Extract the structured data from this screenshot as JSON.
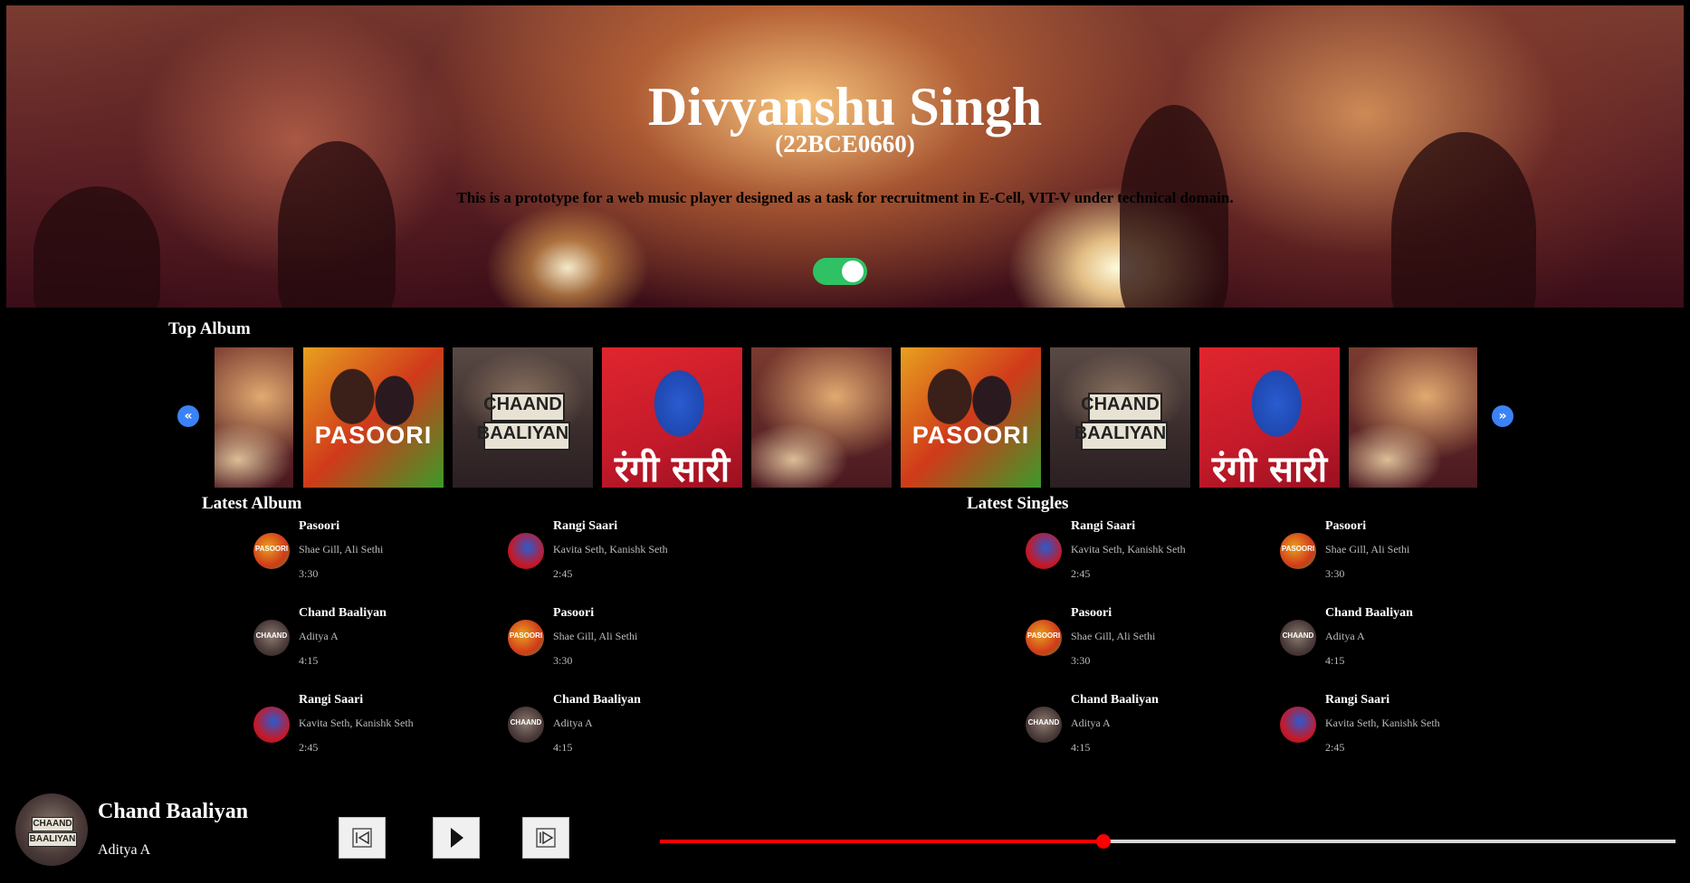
{
  "hero": {
    "title": "Divyanshu Singh",
    "subtitle": "(22BCE0660)",
    "description": "This is a prototype for a web music player designed as a task for recruitment in E-Cell, VIT-V under technical domain.",
    "theme_toggle_on": true
  },
  "top_album": {
    "heading": "Top Album",
    "prev_icon": "double-chevron-left-icon",
    "next_icon": "double-chevron-right-icon",
    "tiles": [
      {
        "kind": "concert",
        "label": ""
      },
      {
        "kind": "pasoori",
        "label": "PASOORI"
      },
      {
        "kind": "chaand",
        "label": "CHAAND",
        "label2": "BAALIYAN"
      },
      {
        "kind": "rangi",
        "label": "रंगी सारी"
      },
      {
        "kind": "concert",
        "label": ""
      },
      {
        "kind": "pasoori",
        "label": "PASOORI"
      },
      {
        "kind": "chaand",
        "label": "CHAAND",
        "label2": "BAALIYAN"
      },
      {
        "kind": "rangi",
        "label": "रंगी सारी"
      },
      {
        "kind": "concert",
        "label": ""
      }
    ]
  },
  "latest_album": {
    "heading": "Latest Album",
    "songs": [
      {
        "name": "Pasoori",
        "artist": "Shae Gill, Ali Sethi",
        "duration": "3:30",
        "cover": "pasoori",
        "cover_text": "PASOORI"
      },
      {
        "name": "Rangi Saari",
        "artist": "Kavita Seth, Kanishk Seth",
        "duration": "2:45",
        "cover": "rangi",
        "cover_text": ""
      },
      {
        "name": "Chand Baaliyan",
        "artist": "Aditya A",
        "duration": "4:15",
        "cover": "chaand",
        "cover_text": "CHAAND"
      },
      {
        "name": "Pasoori",
        "artist": "Shae Gill, Ali Sethi",
        "duration": "3:30",
        "cover": "pasoori",
        "cover_text": "PASOORI"
      },
      {
        "name": "Rangi Saari",
        "artist": "Kavita Seth, Kanishk Seth",
        "duration": "2:45",
        "cover": "rangi",
        "cover_text": ""
      },
      {
        "name": "Chand Baaliyan",
        "artist": "Aditya A",
        "duration": "4:15",
        "cover": "chaand",
        "cover_text": "CHAAND"
      }
    ]
  },
  "latest_singles": {
    "heading": "Latest Singles",
    "songs": [
      {
        "name": "Rangi Saari",
        "artist": "Kavita Seth, Kanishk Seth",
        "duration": "2:45",
        "cover": "rangi",
        "cover_text": ""
      },
      {
        "name": "Pasoori",
        "artist": "Shae Gill, Ali Sethi",
        "duration": "3:30",
        "cover": "pasoori",
        "cover_text": "PASOORI"
      },
      {
        "name": "Pasoori",
        "artist": "Shae Gill, Ali Sethi",
        "duration": "3:30",
        "cover": "pasoori",
        "cover_text": "PASOORI"
      },
      {
        "name": "Chand Baaliyan",
        "artist": "Aditya A",
        "duration": "4:15",
        "cover": "chaand",
        "cover_text": "CHAAND"
      },
      {
        "name": "Chand Baaliyan",
        "artist": "Aditya A",
        "duration": "4:15",
        "cover": "chaand",
        "cover_text": "CHAAND"
      },
      {
        "name": "Rangi Saari",
        "artist": "Kavita Seth, Kanishk Seth",
        "duration": "2:45",
        "cover": "rangi",
        "cover_text": ""
      }
    ]
  },
  "player": {
    "title": "Chand Baaliyan",
    "artist": "Aditya A",
    "cover_text_1": "CHAAND",
    "cover_text_2": "BAALIYAN",
    "progress": 0.437,
    "controls": [
      "previous-track-icon",
      "play-icon",
      "next-track-icon"
    ],
    "accent_color": "#ff0000"
  },
  "colors": {
    "toggle_on": "#2fc164",
    "nav_button": "#3b82f6",
    "progress_track": "#d6d6d6"
  }
}
